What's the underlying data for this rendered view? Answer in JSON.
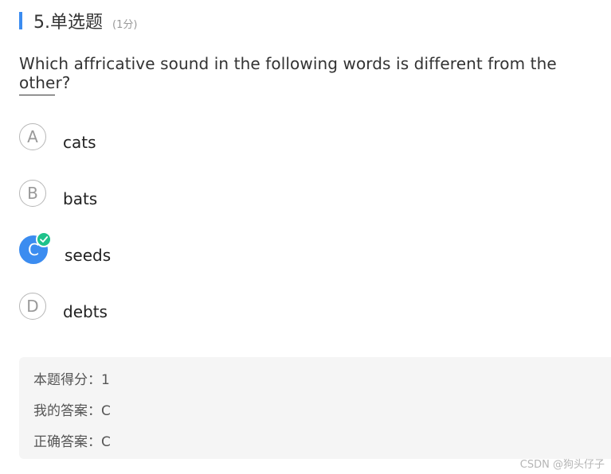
{
  "question": {
    "number_title": "5.单选题",
    "score": "(1分)",
    "text": "Which affricative sound in the following words is different from the other?",
    "options": [
      {
        "letter": "A",
        "text": "cats",
        "selected": false
      },
      {
        "letter": "B",
        "text": "bats",
        "selected": false
      },
      {
        "letter": "C",
        "text": "seeds",
        "selected": true
      },
      {
        "letter": "D",
        "text": "debts",
        "selected": false
      }
    ]
  },
  "result": {
    "score_line": "本题得分：1",
    "my_answer_line": "我的答案：C",
    "correct_answer_line": "正确答案：C"
  },
  "watermark": "CSDN @狗头仔子",
  "colors": {
    "accent": "#3b8cf0",
    "correct_badge": "#1ec28b",
    "result_bg": "#f5f5f5"
  }
}
